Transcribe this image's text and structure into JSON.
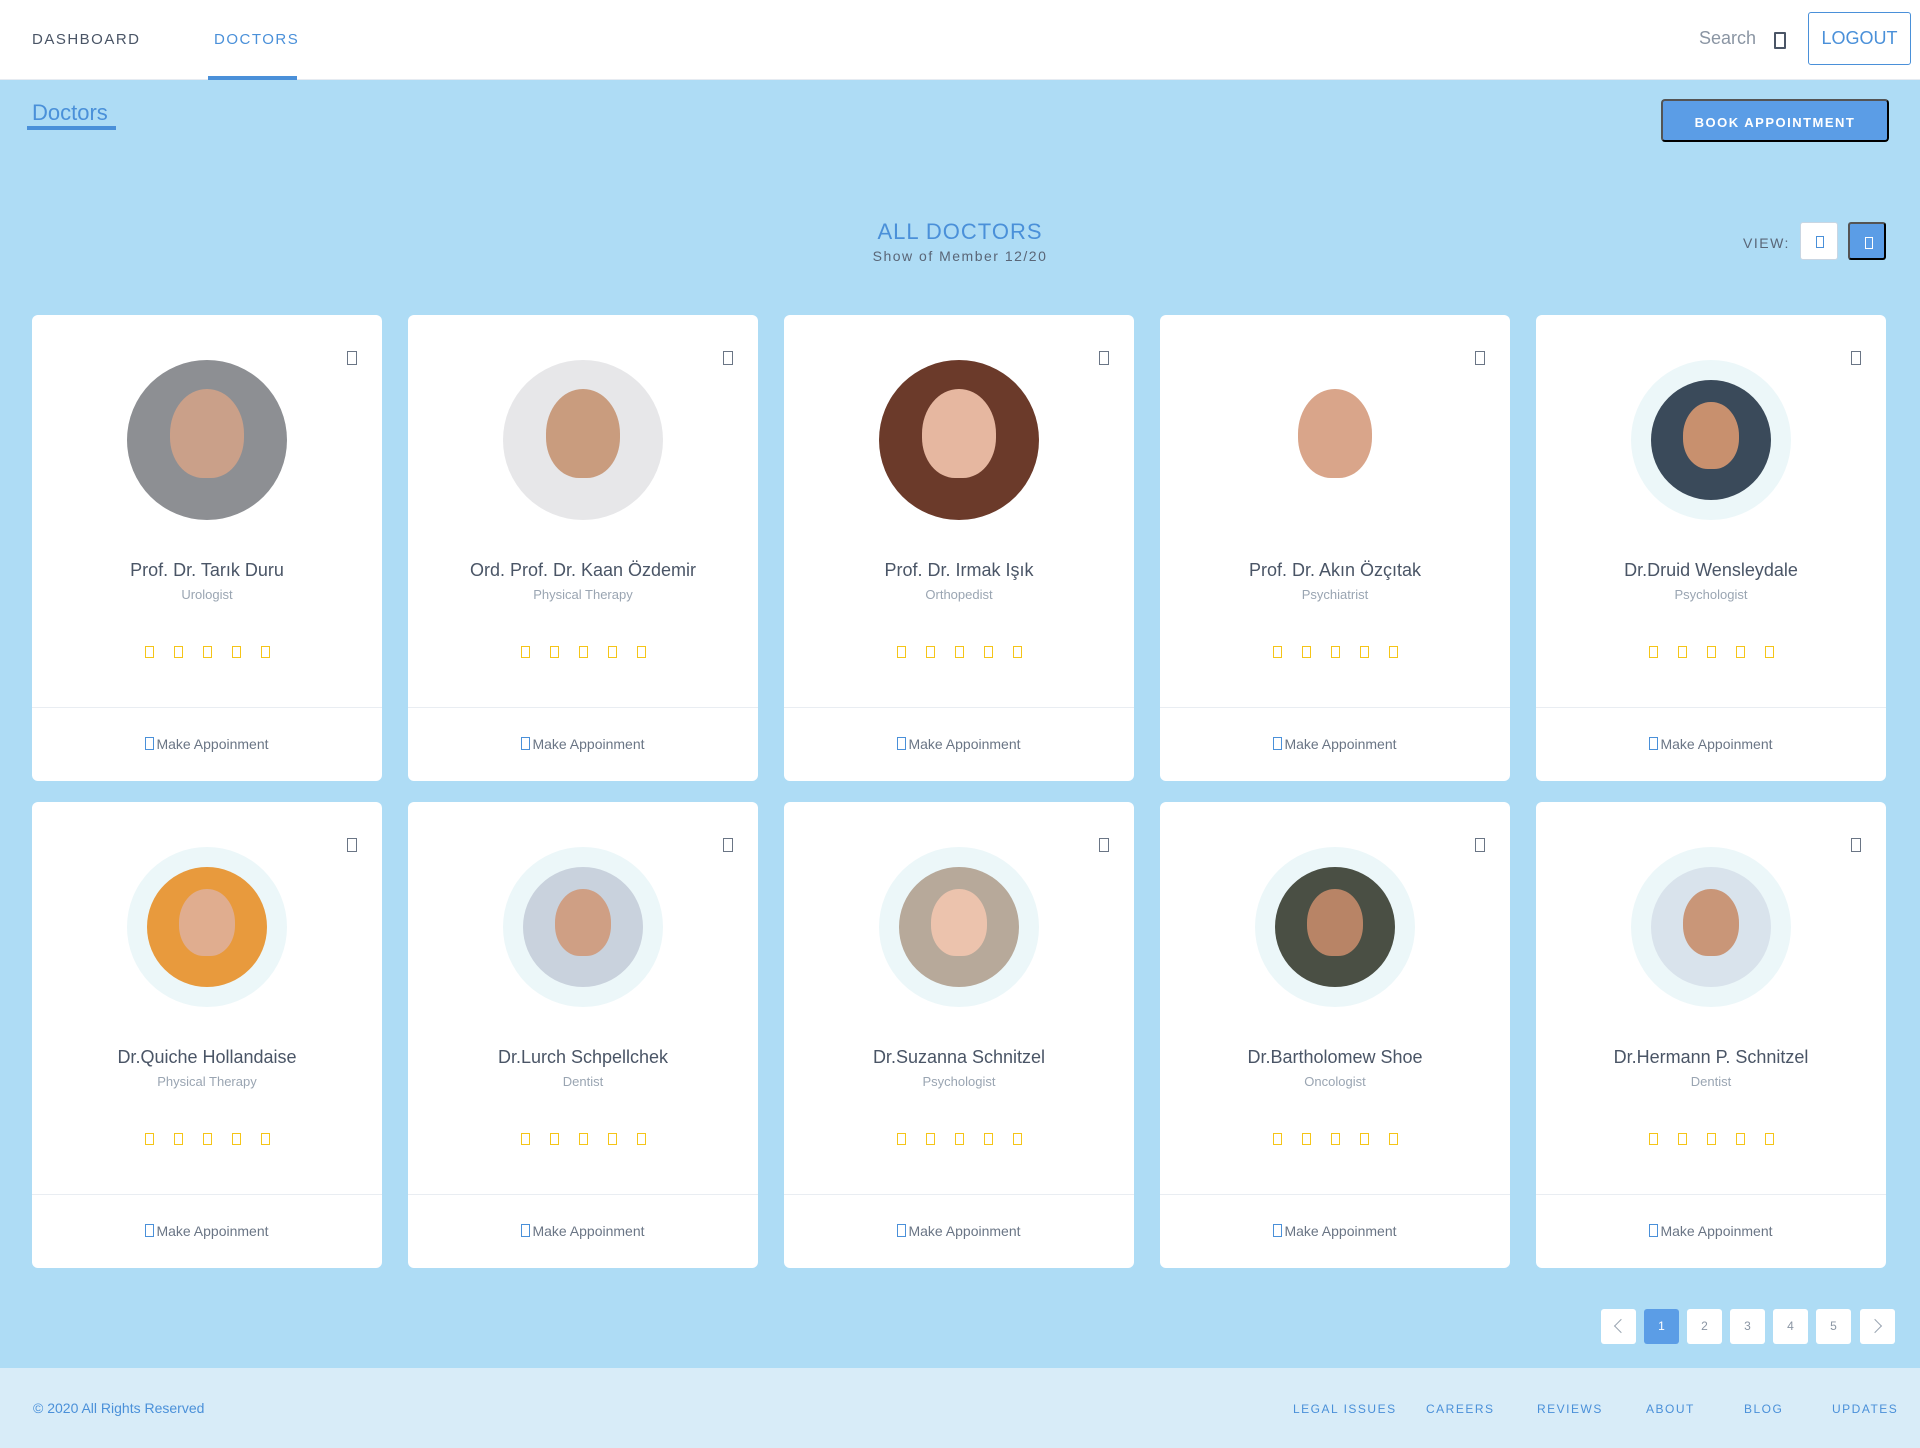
{
  "nav": {
    "items": [
      {
        "label": "DASHBOARD"
      },
      {
        "label": "DOCTORS"
      }
    ],
    "search_label": "Search",
    "logout_label": "LOGOUT"
  },
  "page": {
    "breadcrumb": "Doctors",
    "book_button": "BOOK APPOINTMENT",
    "section_title": "ALL DOCTORS",
    "section_subtitle": "Show of Member 12/20",
    "view_label": "VIEW:"
  },
  "doctors": [
    {
      "name": "Prof. Dr. Tarık Duru",
      "specialty": "Urologist",
      "rating": 5,
      "appointment_label": "Make Appoinment"
    },
    {
      "name": "Ord. Prof. Dr. Kaan Özdemir",
      "specialty": "Physical Therapy",
      "rating": 5,
      "appointment_label": "Make Appoinment"
    },
    {
      "name": "Prof. Dr. Irmak Işık",
      "specialty": "Orthopedist",
      "rating": 5,
      "appointment_label": "Make Appoinment"
    },
    {
      "name": "Prof. Dr. Akın Özçıtak",
      "specialty": "Psychiatrist",
      "rating": 5,
      "appointment_label": "Make Appoinment"
    },
    {
      "name": "Dr.Druid Wensleydale",
      "specialty": "Psychologist",
      "rating": 5,
      "appointment_label": "Make Appoinment"
    },
    {
      "name": "Dr.Quiche Hollandaise",
      "specialty": "Physical Therapy",
      "rating": 5,
      "appointment_label": "Make Appoinment"
    },
    {
      "name": "Dr.Lurch Schpellchek",
      "specialty": "Dentist",
      "rating": 5,
      "appointment_label": "Make Appoinment"
    },
    {
      "name": "Dr.Suzanna Schnitzel",
      "specialty": "Psychologist",
      "rating": 5,
      "appointment_label": "Make Appoinment"
    },
    {
      "name": "Dr.Bartholomew Shoe",
      "specialty": "Oncologist",
      "rating": 5,
      "appointment_label": "Make Appoinment"
    },
    {
      "name": "Dr.Hermann P. Schnitzel",
      "specialty": "Dentist",
      "rating": 5,
      "appointment_label": "Make Appoinment"
    }
  ],
  "pagination": {
    "pages": [
      "1",
      "2",
      "3",
      "4",
      "5"
    ],
    "current": "1"
  },
  "footer": {
    "copyright": "© 2020 All Rights Reserved",
    "links": [
      {
        "label": "LEGAL ISSUES"
      },
      {
        "label": "CAREERS"
      },
      {
        "label": "REVIEWS"
      },
      {
        "label": "ABOUT"
      },
      {
        "label": "BLOG"
      },
      {
        "label": "UPDATES"
      }
    ]
  },
  "colors": {
    "accent": "#4a90d9",
    "button": "#5b9de6",
    "background": "#aedcf5",
    "footer_bg": "#d8ecf8",
    "star": "#f5c518"
  },
  "icons": {
    "search": "search-icon",
    "favorite": "heart-icon",
    "star": "star-icon",
    "appointment": "calendar-icon",
    "view_list": "list-view-icon",
    "view_grid": "grid-view-icon"
  }
}
